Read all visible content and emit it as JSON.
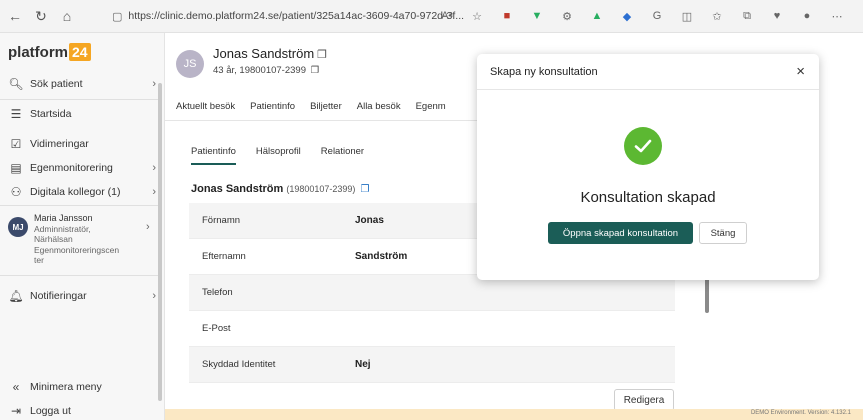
{
  "browser": {
    "url": "https://clinic.demo.platform24.se/patient/325a14ac-3609-4a70-972d-3f...",
    "reader_label": "Aᵃ"
  },
  "sidebar": {
    "logo_text": "platform",
    "logo_num": "24",
    "items": [
      {
        "label": "Sök patient"
      },
      {
        "label": "Startsida"
      },
      {
        "label": "Vidimeringar"
      },
      {
        "label": "Egenmonitorering"
      },
      {
        "label": "Digitala kollegor (1)"
      },
      {
        "label": "Notifieringar"
      },
      {
        "label": "Minimera meny"
      },
      {
        "label": "Logga ut"
      }
    ],
    "user": {
      "initials": "MJ",
      "name": "Maria Jansson",
      "role": "Adminnistratör,",
      "org1": "Närhälsan",
      "org2": "Egenmonitoreringscen",
      "org3": "ter"
    }
  },
  "patient": {
    "initials": "JS",
    "name": "Jonas Sandström",
    "age_pnr": "43 år, 19800107-2399"
  },
  "tabs": [
    "Aktuellt besök",
    "Patientinfo",
    "Biljetter",
    "Alla besök",
    "Egenm"
  ],
  "subtabs": [
    "Patientinfo",
    "Hälsoprofil",
    "Relationer"
  ],
  "section": {
    "name": "Jonas Sandström",
    "pnr": "(19800107-2399)"
  },
  "rows": [
    {
      "label": "Förnamn",
      "value": "Jonas"
    },
    {
      "label": "Efternamn",
      "value": "Sandström"
    },
    {
      "label": "Telefon",
      "value": ""
    },
    {
      "label": "E-Post",
      "value": ""
    },
    {
      "label": "Skyddad Identitet",
      "value": "Nej"
    }
  ],
  "edit_label": "Redigera",
  "footer_env": "DEMO Environment. Version: 4.132.1",
  "modal": {
    "title": "Skapa ny konsultation",
    "close": "×",
    "message": "Konsultation skapad",
    "primary": "Öppna skapad konsultation",
    "secondary": "Stäng"
  },
  "colors": {
    "accent": "#1b5d57",
    "success": "#5cb832",
    "brand_orange": "#f5a623",
    "footer_bg": "#fbe8c4"
  }
}
